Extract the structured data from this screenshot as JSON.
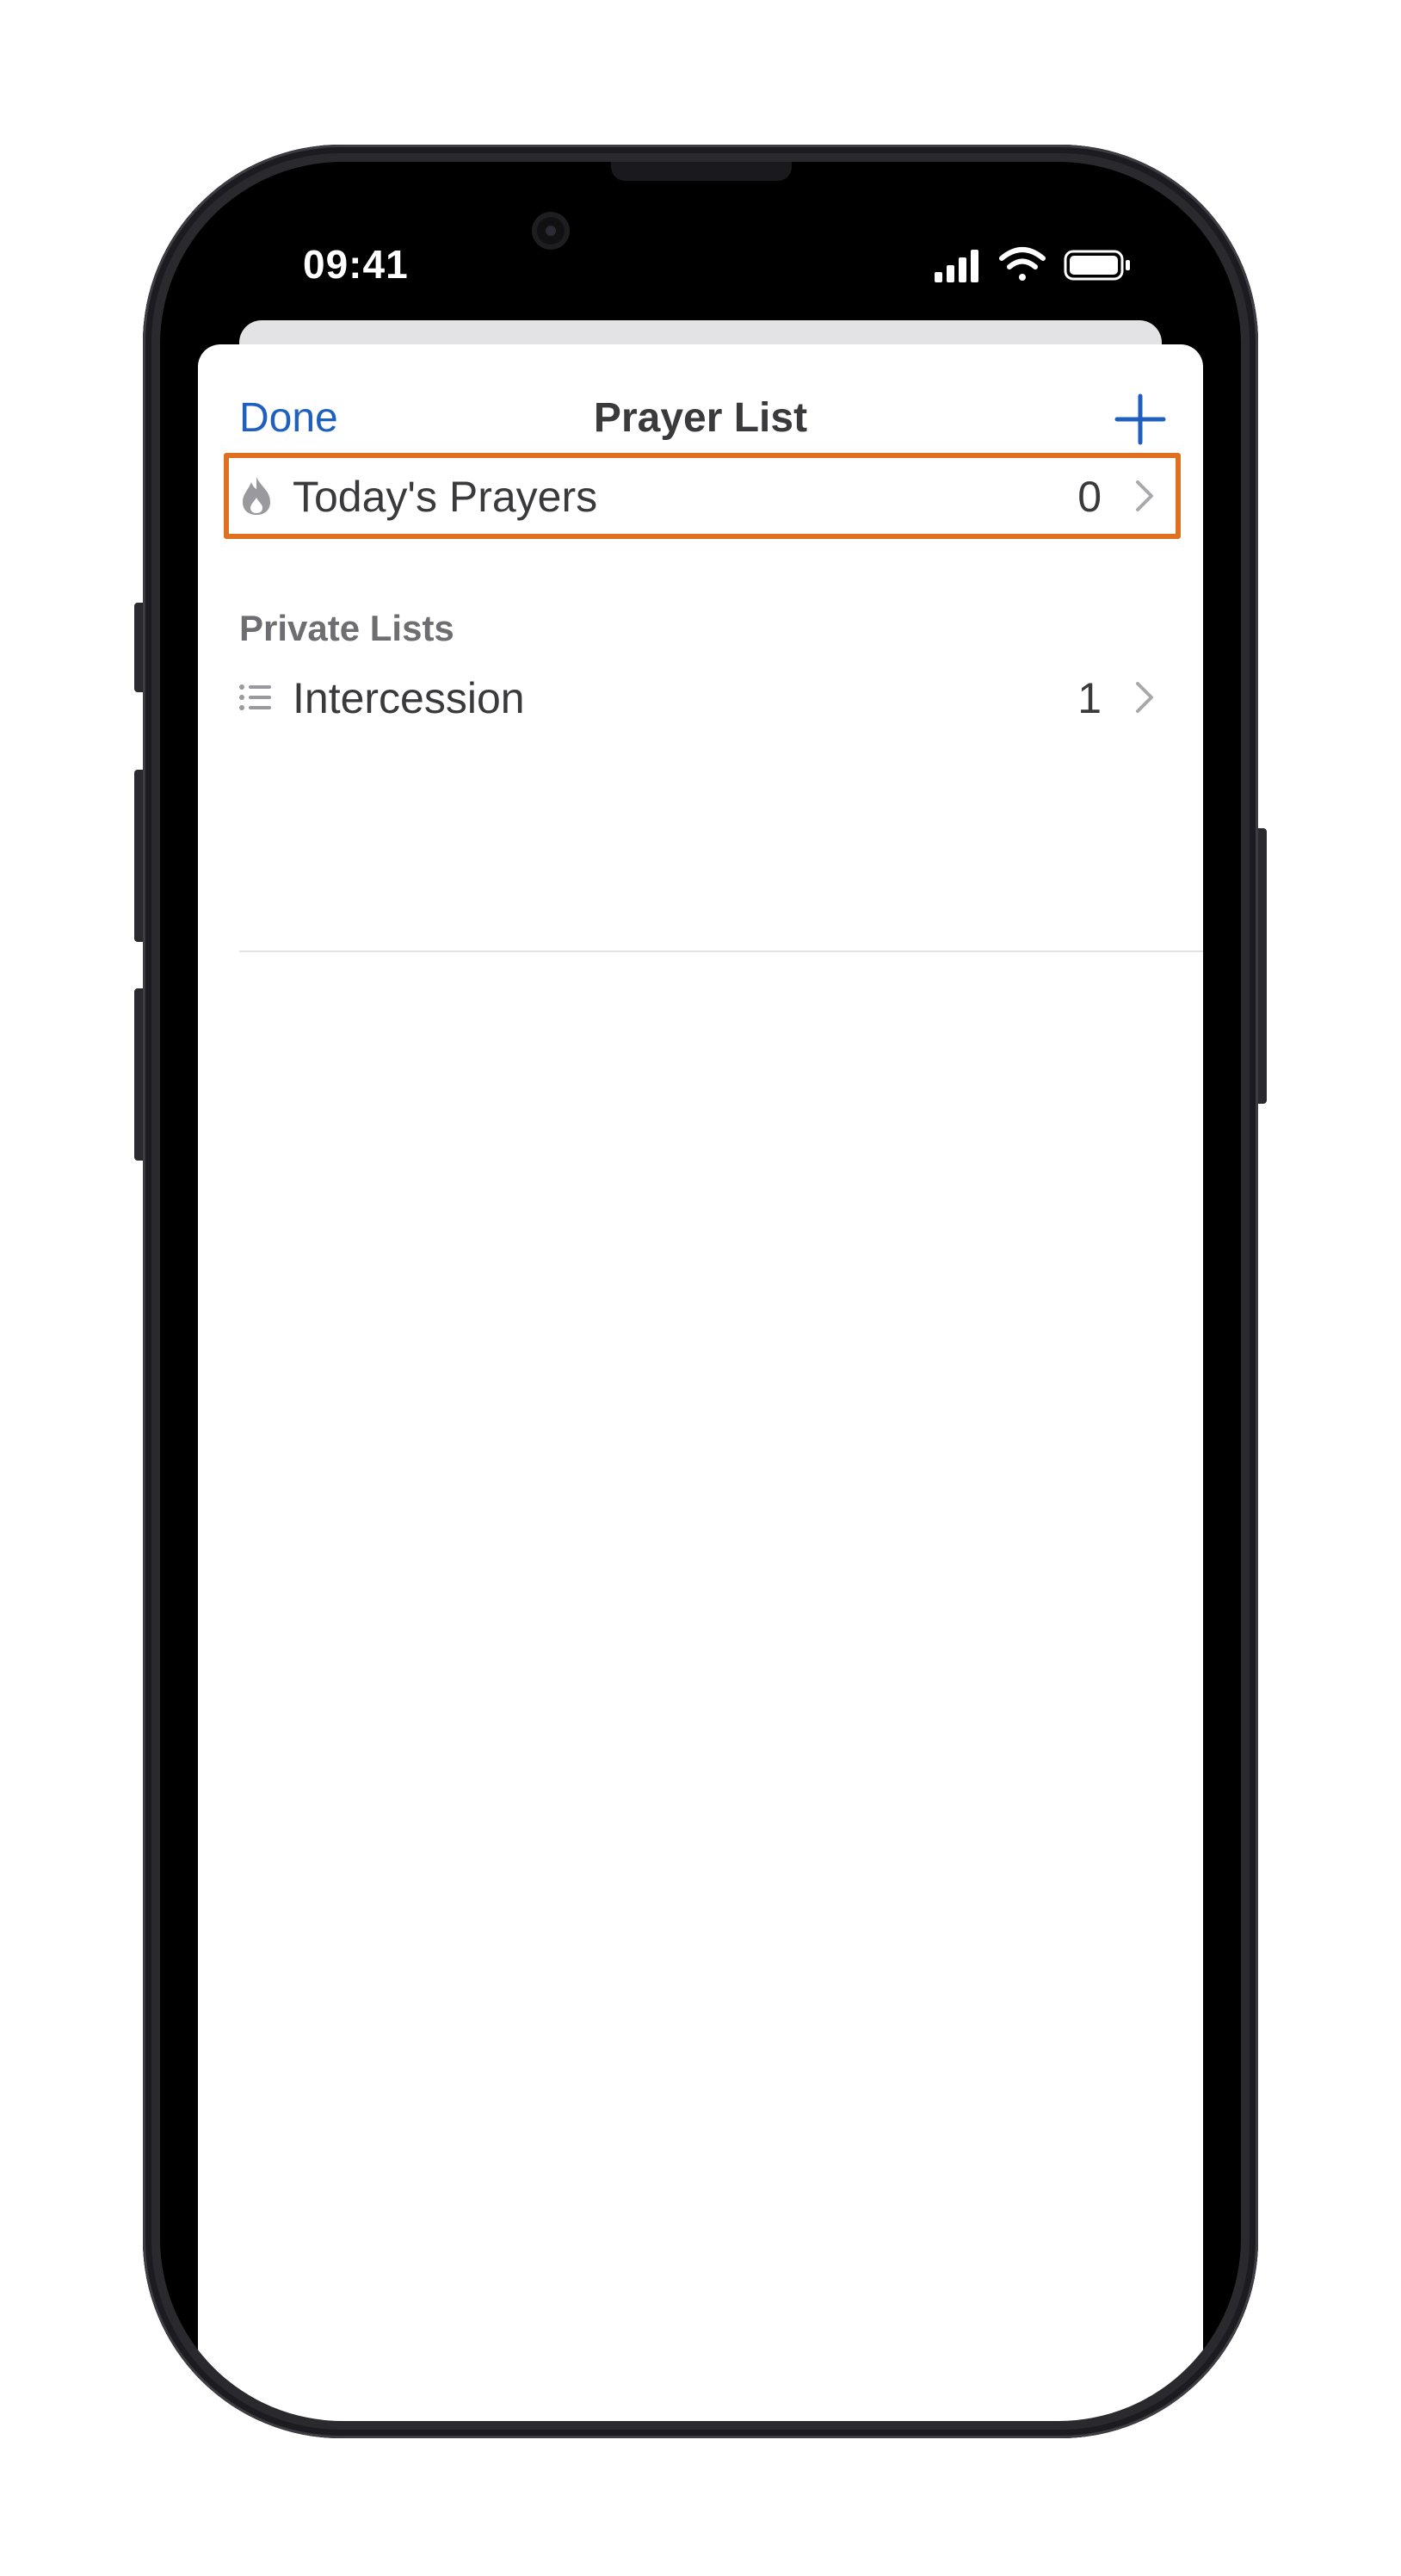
{
  "status_bar": {
    "time": "09:41",
    "icons": [
      "cellular-signal-icon",
      "wifi-icon",
      "battery-icon"
    ]
  },
  "nav": {
    "done_label": "Done",
    "title": "Prayer List",
    "add_icon": "plus-icon"
  },
  "lists": {
    "featured": {
      "label": "Today's Prayers",
      "count": "0",
      "icon": "flame-icon",
      "highlighted": true
    },
    "private_section_title": "Private Lists",
    "private": [
      {
        "label": "Intercession",
        "count": "1",
        "icon": "list-icon"
      }
    ]
  },
  "colors": {
    "accent": "#1f5fbf",
    "highlight_border": "#e07020",
    "text": "#3a3a3c",
    "secondary_text": "#6d6d72",
    "icon_gray": "#9a9a9e"
  }
}
